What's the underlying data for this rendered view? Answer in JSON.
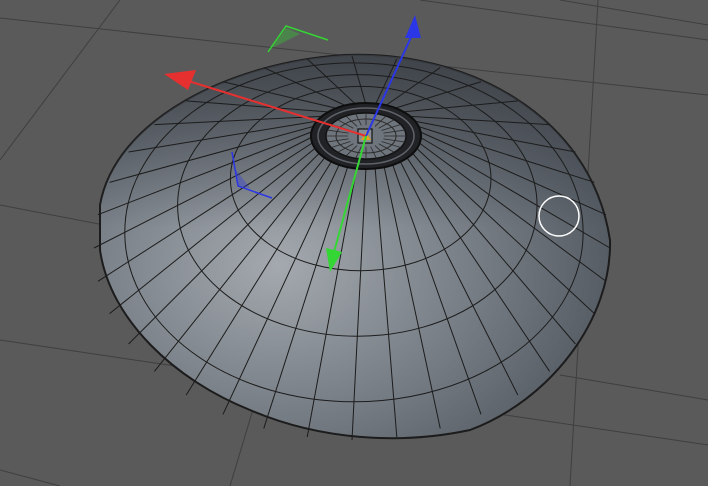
{
  "viewport": {
    "background": "#5a5a5a",
    "grid_color": "#3f3f3f"
  },
  "model": {
    "face_color_light": "#9ba1a7",
    "face_color_dark": "#4a5058",
    "wire_color": "#1c1c1c",
    "radial_segments": 36
  },
  "gizmo": {
    "x_axis": {
      "color": "#e63030",
      "icon": "arrow-x-axis-icon"
    },
    "y_axis": {
      "color": "#33d633",
      "icon": "arrow-y-axis-icon"
    },
    "z_axis": {
      "color": "#2b36e6",
      "icon": "arrow-z-axis-icon"
    },
    "center_icon": "object-center-icon"
  },
  "cursor": {
    "icon": "brush-circle-cursor-icon",
    "color": "#ffffff"
  }
}
